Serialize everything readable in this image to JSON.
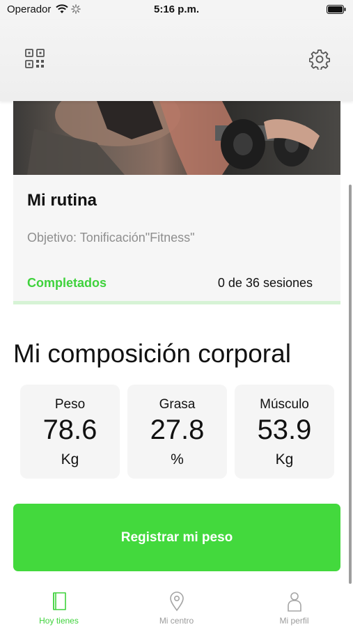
{
  "status_bar": {
    "carrier": "Operador",
    "time": "5:16 p.m."
  },
  "top_nav": {
    "left_icon": "qr-code-icon",
    "right_icon": "gear-icon"
  },
  "routine": {
    "title": "Mi rutina",
    "objective": "Objetivo: Tonificación\"Fitness\"",
    "completed_label": "Completados",
    "sessions_text": "0 de 36 sesiones",
    "progress": 0
  },
  "composition": {
    "title": "Mi composición corporal",
    "metrics": [
      {
        "label": "Peso",
        "value": "78.6",
        "unit": "Kg"
      },
      {
        "label": "Grasa",
        "value": "27.8",
        "unit": "%"
      },
      {
        "label": "Músculo",
        "value": "53.9",
        "unit": "Kg"
      }
    ]
  },
  "register_button": {
    "label": "Registrar mi peso"
  },
  "tab_bar": {
    "tabs": [
      {
        "label": "Hoy tienes",
        "icon": "book-icon",
        "active": true
      },
      {
        "label": "Mi centro",
        "icon": "location-pin-icon",
        "active": false
      },
      {
        "label": "Mi perfil",
        "icon": "person-icon",
        "active": false
      }
    ]
  },
  "colors": {
    "accent": "#3fd23c",
    "button": "#43d93d",
    "muted_text": "#8e8e8e"
  }
}
